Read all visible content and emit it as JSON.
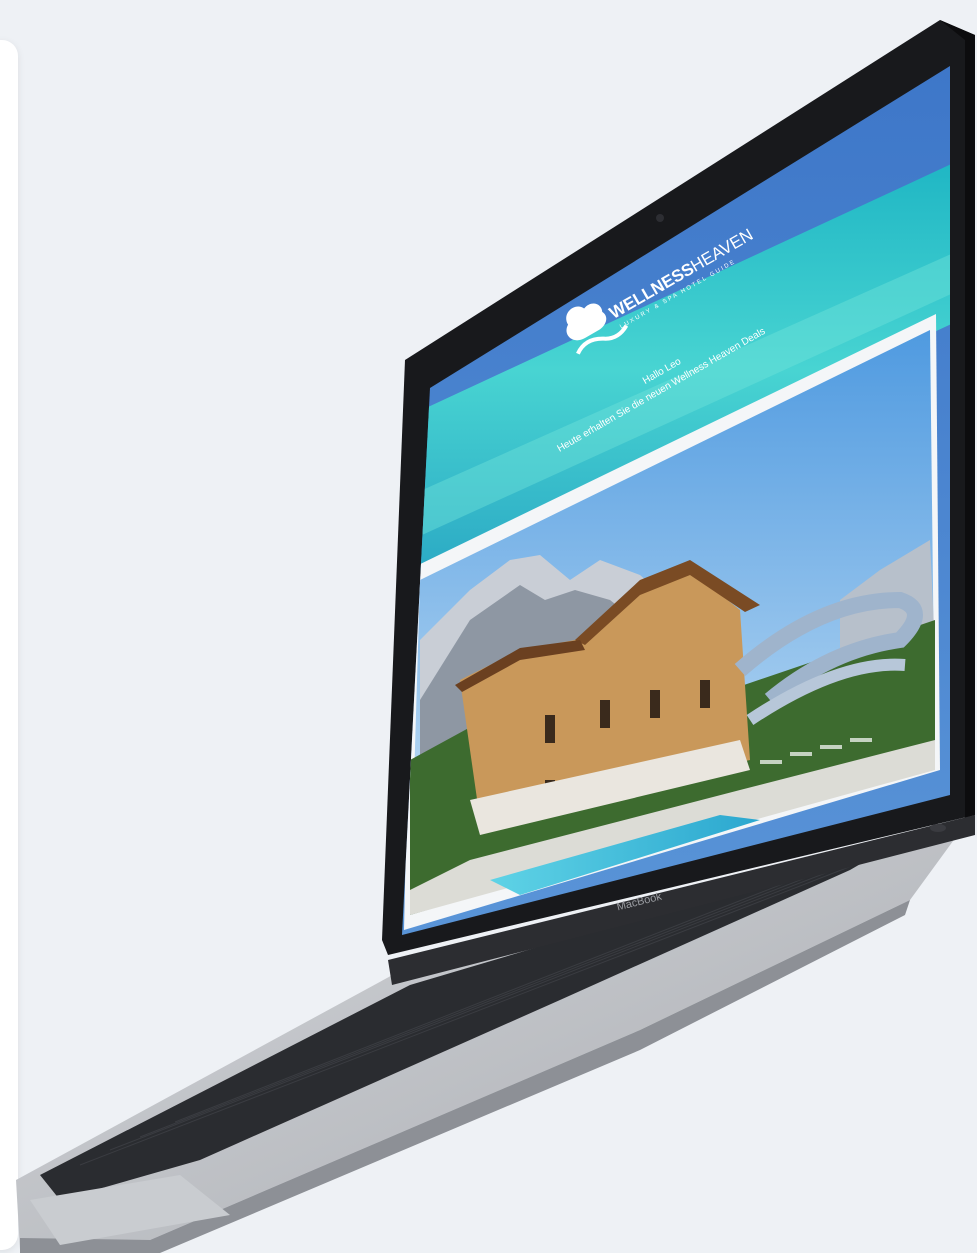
{
  "device": {
    "brand_label": "MacBook"
  },
  "email": {
    "logo_name": "cloud-wave-logo-icon",
    "brand_bold": "WELLNESS",
    "brand_light": "HEAVEN",
    "tagline": "LUXURY & SPA HOTEL GUIDE",
    "greeting": "Hallo Leo",
    "subline": "Heute erhalten Sie die neuen Wellness Heaven Deals",
    "hero_image": "hotel-chalet-with-pool-and-waterslide"
  },
  "colors": {
    "background": "#eef1f5",
    "lid": "#1a1b1e",
    "sky": "#3f7fcf",
    "sea": "#2ec4cc",
    "body": "#bfc2c7",
    "keyboard": "#2a2c30"
  }
}
